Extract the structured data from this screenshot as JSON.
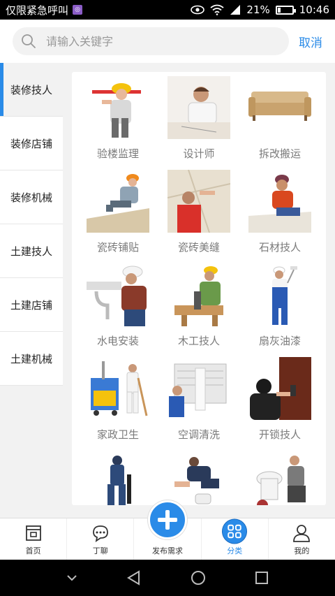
{
  "status_bar": {
    "carrier": "仅限紧急呼叫",
    "sim_badge": "◎",
    "battery_percent": "21%",
    "battery_level": 0.21,
    "time": "10:46"
  },
  "search": {
    "placeholder": "请输入关键字",
    "cancel_label": "取消"
  },
  "sidebar": {
    "items": [
      {
        "label": "装修技人",
        "active": true
      },
      {
        "label": "装修店铺",
        "active": false
      },
      {
        "label": "装修机械",
        "active": false
      },
      {
        "label": "土建技人",
        "active": false
      },
      {
        "label": "土建店铺",
        "active": false
      },
      {
        "label": "土建机械",
        "active": false
      }
    ]
  },
  "grid": {
    "items": [
      {
        "label": "验楼监理",
        "icon": "inspector-photo"
      },
      {
        "label": "设计师",
        "icon": "designer-photo"
      },
      {
        "label": "拆改搬运",
        "icon": "sofa-photo"
      },
      {
        "label": "瓷砖铺贴",
        "icon": "tiler-photo"
      },
      {
        "label": "瓷砖美缝",
        "icon": "grout-photo"
      },
      {
        "label": "石材技人",
        "icon": "stone-worker-photo"
      },
      {
        "label": "水电安装",
        "icon": "plumber-photo"
      },
      {
        "label": "木工技人",
        "icon": "carpenter-photo"
      },
      {
        "label": "扇灰油漆",
        "icon": "painter-photo"
      },
      {
        "label": "家政卫生",
        "icon": "cleaner-photo"
      },
      {
        "label": "空调清洗",
        "icon": "ac-cleaning-photo"
      },
      {
        "label": "开锁技人",
        "icon": "locksmith-photo"
      },
      {
        "label": "",
        "icon": "worker-drill-photo"
      },
      {
        "label": "",
        "icon": "floor-worker-photo"
      },
      {
        "label": "",
        "icon": "toilet-installer-photo"
      }
    ]
  },
  "tabbar": {
    "tabs": [
      {
        "label": "首页",
        "icon": "home-icon"
      },
      {
        "label": "丁聊",
        "icon": "chat-icon"
      },
      {
        "label": "发布需求",
        "icon": "plus-icon"
      },
      {
        "label": "分类",
        "icon": "category-icon"
      },
      {
        "label": "我的",
        "icon": "user-icon"
      }
    ]
  },
  "colors": {
    "accent": "#2a8be8",
    "background": "#f2f2f2"
  }
}
